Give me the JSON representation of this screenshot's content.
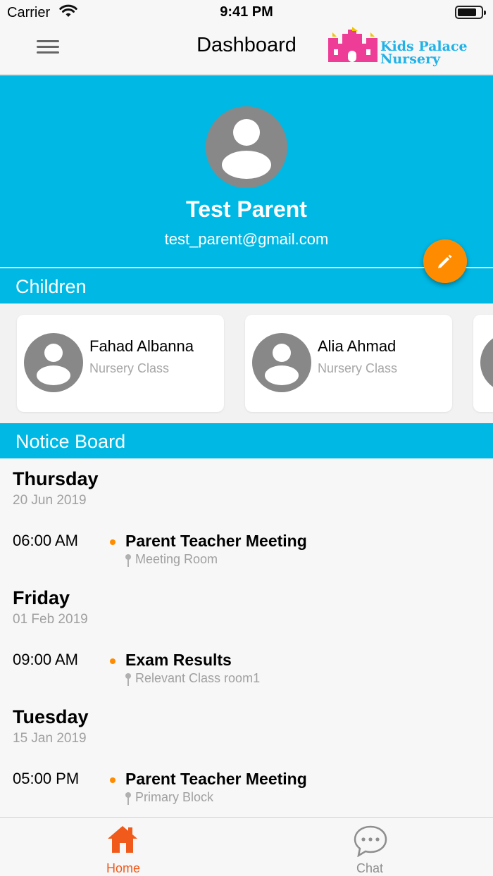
{
  "status_bar": {
    "carrier": "Carrier",
    "time": "9:41 PM"
  },
  "nav": {
    "title": "Dashboard",
    "logo_line1": "Kids Palace",
    "logo_line2": "Nursery"
  },
  "profile": {
    "name": "Test Parent",
    "email": "test_parent@gmail.com"
  },
  "sections": {
    "children": "Children",
    "notice_board": "Notice Board"
  },
  "children": [
    {
      "name": "Fahad Albanna",
      "class": "Nursery Class"
    },
    {
      "name": "Alia Ahmad",
      "class": "Nursery Class"
    }
  ],
  "notices": [
    {
      "day": "Thursday",
      "date": "20 Jun 2019",
      "time": "06:00 AM",
      "title": "Parent Teacher Meeting",
      "location": "Meeting Room"
    },
    {
      "day": "Friday",
      "date": "01 Feb 2019",
      "time": "09:00 AM",
      "title": "Exam Results",
      "location": "Relevant Class room1"
    },
    {
      "day": "Tuesday",
      "date": "15 Jan 2019",
      "time": "05:00 PM",
      "title": "Parent Teacher Meeting",
      "location": "Primary Block"
    }
  ],
  "tabs": {
    "home": "Home",
    "chat": "Chat"
  },
  "colors": {
    "primary": "#00b8e4",
    "accent": "#ff8c00",
    "active_tab": "#f05a1a",
    "inactive_tab": "#8e8e8e"
  },
  "icons": [
    "menu-icon",
    "wifi-icon",
    "battery-icon",
    "avatar-icon",
    "pencil-icon",
    "location-pin-icon",
    "home-icon",
    "chat-bubble-icon"
  ]
}
